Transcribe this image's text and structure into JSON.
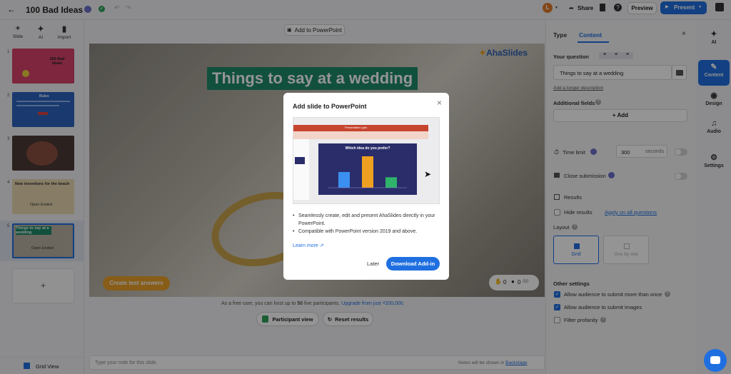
{
  "header": {
    "title": "100 Bad Ideas",
    "avatar_initial": "L",
    "share_label": "Share",
    "preview_label": "Preview",
    "present_label": "Present"
  },
  "left_toolbar": {
    "slide_label": "Slide",
    "ai_label": "AI",
    "import_label": "Import",
    "grid_view_label": "Grid View"
  },
  "thumbnails": [
    {
      "number": "1",
      "text": "100 Bad Ideas"
    },
    {
      "number": "2",
      "text": "Rules"
    },
    {
      "number": "3",
      "text": ""
    },
    {
      "number": "4",
      "text": "New inventions for the beach",
      "subtext": "Open Ended"
    },
    {
      "number": "5",
      "text": "Things to say at a wedding",
      "subtext": "Open Ended"
    }
  ],
  "canvas": {
    "add_to_pp_label": "Add to PowerPoint",
    "brand": "AhaSlides",
    "slide_title": "Things to say at a wedding",
    "create_test_label": "Create test answers",
    "hands_count": "0",
    "people_count": "0",
    "people_max": "/50",
    "free_notice_prefix": "As a free user, you can host up to",
    "free_notice_bold": "50",
    "free_notice_mid": "live participants.",
    "upgrade_link": "Upgrade from just ₫200,000.",
    "participant_view_label": "Participant view",
    "reset_results_label": "Reset results",
    "notes_placeholder": "Type your note for this slide.",
    "notes_shown_prefix": "Notes will be shown in",
    "notes_shown_link": "Backstage"
  },
  "modal": {
    "title": "Add slide to PowerPoint",
    "preview_header": "Presentation.pptx",
    "preview_question": "Which idea do you prefer?",
    "bullets": [
      "Seamlessly create, edit and present AhaSlides directly in your PowerPoint.",
      "Compatible with PowerPoint version 2019 and above."
    ],
    "learn_more": "Learn more",
    "later_label": "Later",
    "download_label": "Download Add-in"
  },
  "right_panel": {
    "tab_type": "Type",
    "tab_content": "Content",
    "your_question_label": "Your question",
    "question_value": "Things to say at a wedding",
    "add_description": "Add a longer description",
    "additional_fields": "Additional fields",
    "add_label": "+ Add",
    "time_limit_label": "Time limit",
    "time_value": "300",
    "time_unit": "seconds",
    "close_submission": "Close submission",
    "results_label": "Results",
    "hide_results": "Hide results",
    "apply_all": "Apply on all questions",
    "layout_label": "Layout",
    "layout_grid": "Grid",
    "layout_one": "One by one",
    "other_settings": "Other settings",
    "opt1": "Allow audience to submit more than once",
    "opt2": "Allow audience to submit images",
    "opt3": "Filter profanity"
  },
  "right_rail": {
    "ai": "AI",
    "content": "Content",
    "design": "Design",
    "audio": "Audio",
    "settings": "Settings"
  },
  "colors": {
    "accent": "#1f6fe0",
    "title_bg": "#1e8a6a",
    "create_test_bg": "#e8a02a",
    "thumb1": "#d8426b",
    "thumb2": "#2b62c0"
  },
  "chart_data": {
    "type": "bar",
    "title": "Which idea do you prefer?",
    "categories": [
      "",
      "",
      ""
    ],
    "values": [
      18,
      36,
      12
    ],
    "colors": [
      "#3a8ff0",
      "#f0a020",
      "#2fb36a"
    ]
  }
}
